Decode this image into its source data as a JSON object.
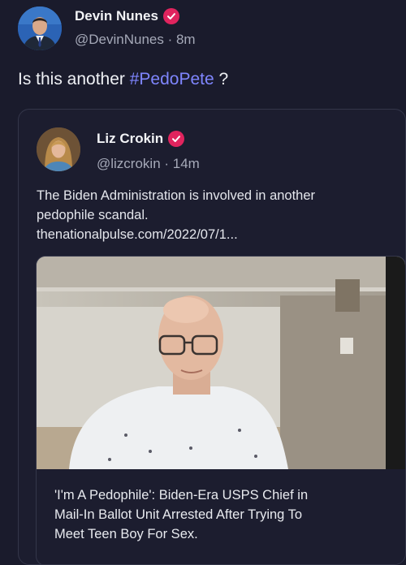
{
  "post": {
    "author_name": "Devin Nunes",
    "handle_time": "@DevinNunes · 8m",
    "text_prefix": "Is this another ",
    "hashtag": "#PedoPete",
    "text_suffix": " ?",
    "verified_icon": "verified-badge-icon"
  },
  "quote": {
    "author_name": "Liz Crokin",
    "handle_time": "@lizcrokin · 14m",
    "text_lines": [
      "The Biden Administration is involved in another",
      "pedophile scandal.",
      "thenationalpulse.com/2022/07/1..."
    ],
    "card": {
      "title_lines": [
        "'I'm A Pedophile': Biden-Era USPS Chief in",
        "Mail-In Ballot Unit Arrested After Trying To",
        "Meet Teen Boy For Sex."
      ]
    }
  },
  "colors": {
    "background": "#1a1b2c",
    "hashtag": "#7f86ff",
    "verified_badge": "#e0245e"
  }
}
